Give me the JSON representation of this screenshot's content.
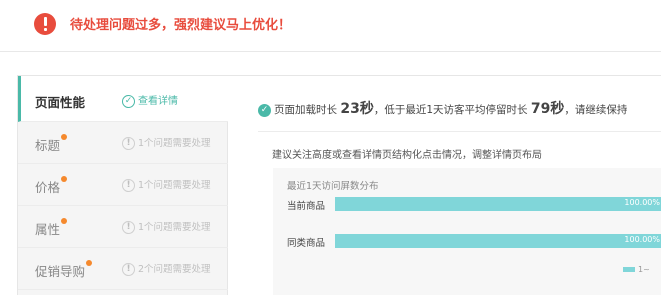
{
  "alert": {
    "text": "待处理问题过多，强烈建议马上优化！",
    "icon": "exclamation-circle-icon",
    "color": "#e84c3d"
  },
  "sidebar": {
    "items": [
      {
        "label": "页面性能",
        "status": "查看详情",
        "active": true,
        "dot": false
      },
      {
        "label": "标题",
        "status": "1个问题需要处理",
        "active": false,
        "dot": true
      },
      {
        "label": "价格",
        "status": "1个问题需要处理",
        "active": false,
        "dot": true
      },
      {
        "label": "属性",
        "status": "1个问题需要处理",
        "active": false,
        "dot": true
      },
      {
        "label": "促销导购",
        "status": "2个问题需要处理",
        "active": false,
        "dot": true
      }
    ]
  },
  "main": {
    "summary": {
      "part1": "页面加载时长",
      "load_time": "23秒",
      "part2": "，低于最近1天访客平均停留时长",
      "stay_time": "79秒",
      "part3": "，请继续保持"
    },
    "suggestion": "建议关注高度或查看详情页结构化点击情况，调整详情页布局"
  },
  "chart_data": {
    "type": "bar",
    "title": "最近1天访问屏数分布",
    "categories": [
      "当前商品",
      "同类商品"
    ],
    "values": [
      100.0,
      100.0
    ],
    "value_labels": [
      "100.00%",
      "100.00%"
    ],
    "xlim": [
      0,
      100
    ],
    "color": "#80d6d9",
    "legend": "1~",
    "legend_placement": "bottom-right"
  },
  "colors": {
    "accent": "#4ab9a8",
    "dot": "#f5892d",
    "bar": "#80d6d9"
  }
}
